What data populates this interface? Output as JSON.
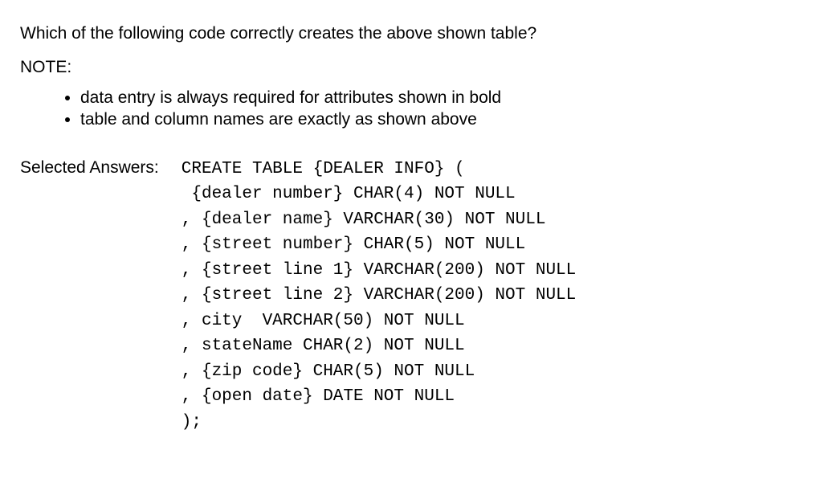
{
  "question": "Which of the following code correctly creates the above shown table?",
  "noteLabel": "NOTE:",
  "notes": [
    "data entry is always required for attributes shown in bold",
    "table and column names are exactly as shown above"
  ],
  "answerLabel": "Selected Answers:",
  "code": "CREATE TABLE {DEALER INFO} (\n {dealer number} CHAR(4) NOT NULL\n, {dealer name} VARCHAR(30) NOT NULL\n, {street number} CHAR(5) NOT NULL\n, {street line 1} VARCHAR(200) NOT NULL\n, {street line 2} VARCHAR(200) NOT NULL\n, city  VARCHAR(50) NOT NULL\n, stateName CHAR(2) NOT NULL\n, {zip code} CHAR(5) NOT NULL\n, {open date} DATE NOT NULL\n);"
}
